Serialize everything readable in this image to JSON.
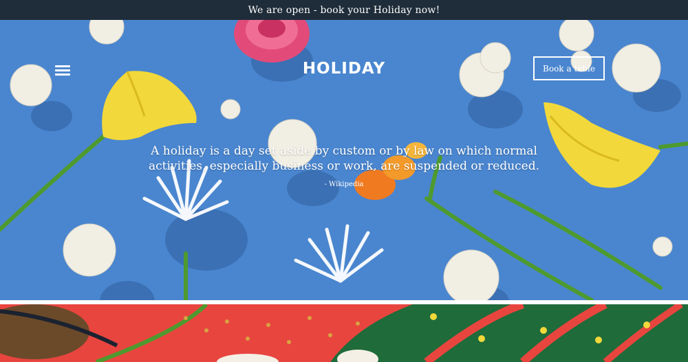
{
  "announcement": {
    "text": "We are open - book your Holiday now!"
  },
  "header": {
    "logo": "HOLIDAY",
    "book_button_label": "Book a table",
    "menu_icon": "hamburger-menu-icon"
  },
  "hero": {
    "quote": "A holiday is a day set aside by custom or by law on which normal activities, especially business or work, are suspended or reduced.",
    "attribution": "- Wikipedia",
    "background_color": "#4a86cf"
  },
  "colors": {
    "topbar": "#1f2c39",
    "hero_bg": "#4a86cf",
    "bottom_bg": "#e8453f",
    "text": "#ffffff"
  }
}
